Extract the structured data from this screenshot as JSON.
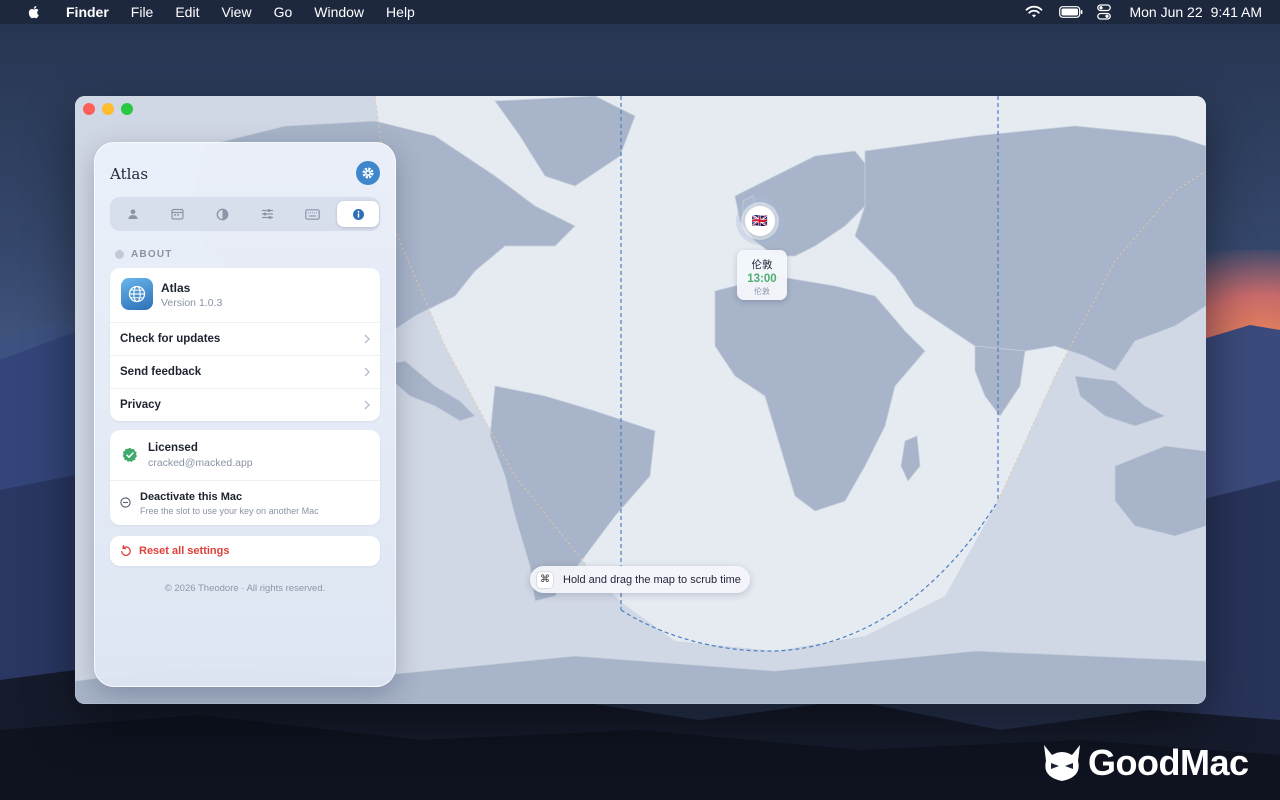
{
  "menubar": {
    "app": "Finder",
    "menus": [
      "File",
      "Edit",
      "View",
      "Go",
      "Window",
      "Help"
    ],
    "date": "Mon Jun 22",
    "time": "9:41 AM",
    "icons": [
      "wifi-icon",
      "battery-icon",
      "control-center-icon"
    ]
  },
  "panel": {
    "title": "Atlas",
    "tabs": [
      "person-icon",
      "calendar-icon",
      "contrast-icon",
      "sliders-icon",
      "keyboard-icon",
      "info-icon"
    ],
    "active_tab": 5,
    "section_label": "ABOUT",
    "app": {
      "name": "Atlas",
      "version": "Version 1.0.3"
    },
    "links": [
      {
        "label": "Check for updates"
      },
      {
        "label": "Send feedback"
      },
      {
        "label": "Privacy"
      }
    ],
    "license": {
      "status": "Licensed",
      "email": "cracked@macked.app",
      "deactivate_label": "Deactivate this Mac",
      "deactivate_sub": "Free the slot to use your key on another Mac"
    },
    "reset_label": "Reset all settings",
    "footer": "© 2026 Theodore · All rights reserved."
  },
  "map": {
    "pin": {
      "flag": "🇬🇧",
      "city": "伦敦",
      "time": "13:00",
      "sub": "伦敦"
    },
    "hint_key": "⌘",
    "hint": "Hold and drag the map to scrub time"
  },
  "watermark": "GoodMac",
  "colors": {
    "accent": "#3f87cc",
    "success": "#3faa6a",
    "danger": "#e0413a",
    "time_green": "#4fae73"
  }
}
